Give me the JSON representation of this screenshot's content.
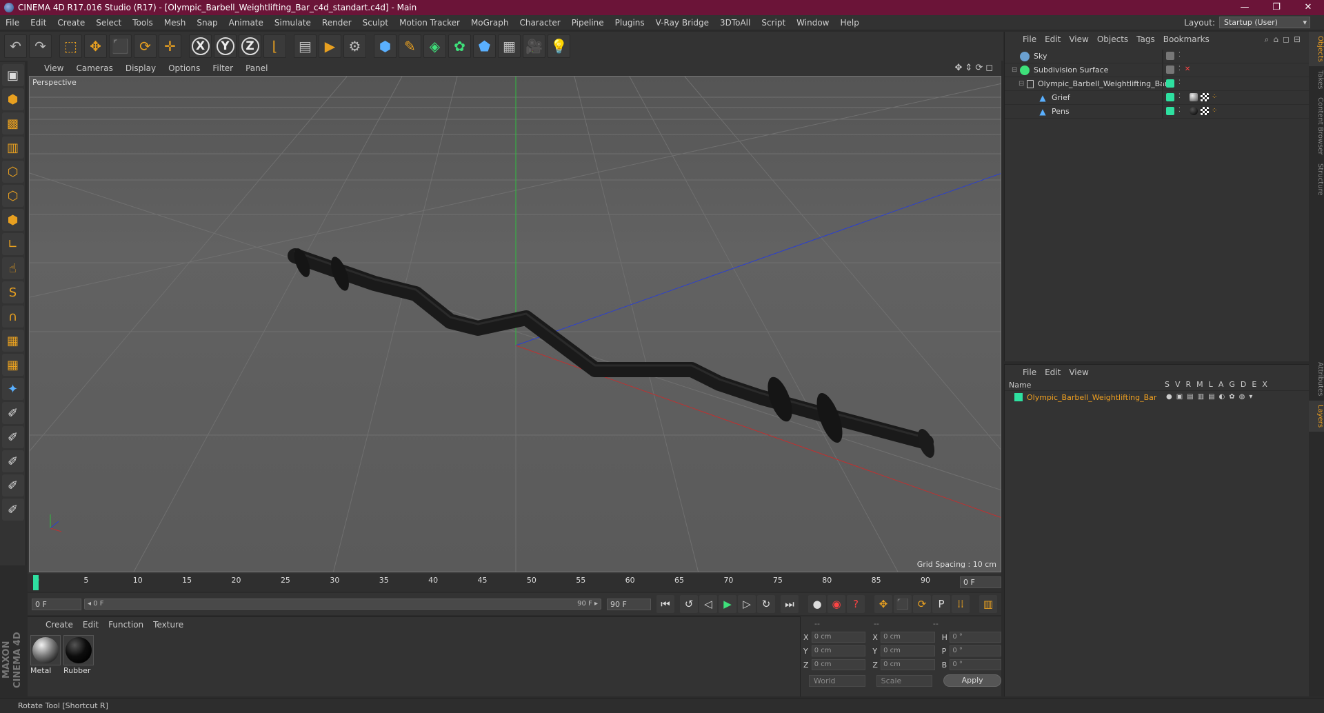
{
  "window": {
    "title": "CINEMA 4D R17.016 Studio (R17) - [Olympic_Barbell_Weightlifting_Bar_c4d_standart.c4d] - Main",
    "minimize": "—",
    "restore": "❐",
    "close": "✕"
  },
  "menubar": {
    "items": [
      "File",
      "Edit",
      "Create",
      "Select",
      "Tools",
      "Mesh",
      "Snap",
      "Animate",
      "Simulate",
      "Render",
      "Sculpt",
      "Motion Tracker",
      "MoGraph",
      "Character",
      "Pipeline",
      "Plugins",
      "V-Ray Bridge",
      "3DToAll",
      "Script",
      "Window",
      "Help"
    ],
    "layout_label": "Layout:",
    "layout_value": "Startup (User)"
  },
  "toolbar": {
    "undo": "↶",
    "redo": "↷",
    "select": "⬚",
    "move": "✥",
    "scale": "⬛",
    "rotate": "⟳",
    "add": "✛",
    "x": "X",
    "y": "Y",
    "z": "Z",
    "coord": "⌊",
    "render_view": "▤",
    "render": "▶",
    "render_settings": "⚙",
    "cube": "⬢",
    "pen": "✎",
    "subdiv": "◈",
    "array": "✿",
    "deformer": "⬟",
    "floor": "▦",
    "camera": "🎥",
    "light": "💡"
  },
  "left_tools": {
    "items": [
      {
        "name": "make-editable-icon",
        "glyph": "▣"
      },
      {
        "name": "model-mode-icon",
        "glyph": "⬢"
      },
      {
        "name": "texture-mode-icon",
        "glyph": "▩"
      },
      {
        "name": "workplane-icon",
        "glyph": "▥"
      },
      {
        "name": "points-mode-icon",
        "glyph": "⬡"
      },
      {
        "name": "edges-mode-icon",
        "glyph": "⬡"
      },
      {
        "name": "polygons-mode-icon",
        "glyph": "⬢"
      },
      {
        "name": "axis-mode-icon",
        "glyph": "∟"
      },
      {
        "name": "tweak-icon",
        "glyph": "☝"
      },
      {
        "name": "snap-icon",
        "glyph": "S"
      },
      {
        "name": "magnet-icon",
        "glyph": "∩"
      },
      {
        "name": "grid-lock-icon",
        "glyph": "▦"
      },
      {
        "name": "grid-sync-icon",
        "glyph": "▦"
      },
      {
        "name": "python-icon",
        "glyph": "✦"
      },
      {
        "name": "sculpt-brush-icon",
        "glyph": "✐"
      },
      {
        "name": "sculpt-smooth-icon",
        "glyph": "✐"
      },
      {
        "name": "sculpt-pull-icon",
        "glyph": "✐"
      },
      {
        "name": "sculpt-grab-icon",
        "glyph": "✐"
      },
      {
        "name": "sculpt-knife-icon",
        "glyph": "✐"
      }
    ]
  },
  "viewport": {
    "menu": [
      "View",
      "Cameras",
      "Display",
      "Options",
      "Filter",
      "Panel"
    ],
    "nav_icons": "✥⇕⟳◻",
    "label": "Perspective",
    "grid_spacing": "Grid Spacing : 10 cm"
  },
  "timeline": {
    "ticks": [
      "0",
      "5",
      "10",
      "15",
      "20",
      "25",
      "30",
      "35",
      "40",
      "45",
      "50",
      "55",
      "60",
      "65",
      "70",
      "75",
      "80",
      "85",
      "90"
    ],
    "current_frame": "0 F",
    "start_field": "0 F",
    "scrub_start": "◂ 0 F",
    "scrub_end": "90 F ▸",
    "end_field": "90 F"
  },
  "transport": {
    "first": "⏮",
    "prev_key": "↺",
    "prev": "◁",
    "play": "▶",
    "next": "▷",
    "next_key": "↻",
    "last": "⏭",
    "record": "●",
    "autokey": "◉",
    "keyinfo": "?",
    "pos": "✥",
    "scale": "⬛",
    "rot": "⟳",
    "param": "P",
    "pla": "⁞⁞",
    "timeline": "▥"
  },
  "materials": {
    "menu": [
      "Create",
      "Edit",
      "Function",
      "Texture"
    ],
    "items": [
      {
        "name": "Metal",
        "color": "#9a9a9a"
      },
      {
        "name": "Rubber",
        "color": "#111111"
      }
    ]
  },
  "coordinates": {
    "head": [
      "--",
      "--",
      "--"
    ],
    "rows": [
      {
        "a1": "X",
        "v1": "0 cm",
        "a2": "X",
        "v2": "0 cm",
        "a3": "H",
        "v3": "0 °"
      },
      {
        "a1": "Y",
        "v1": "0 cm",
        "a2": "Y",
        "v2": "0 cm",
        "a3": "P",
        "v3": "0 °"
      },
      {
        "a1": "Z",
        "v1": "0 cm",
        "a2": "Z",
        "v2": "0 cm",
        "a3": "B",
        "v3": "0 °"
      }
    ],
    "world": "World",
    "scale": "Scale",
    "apply": "Apply"
  },
  "status": {
    "text": "Rotate Tool [Shortcut R]"
  },
  "brand": "MAXON CINEMA 4D",
  "objects": {
    "menu": [
      "File",
      "Edit",
      "View",
      "Objects",
      "Tags",
      "Bookmarks"
    ],
    "header_icons": "⌕⌂◻⊟",
    "rows": [
      {
        "label": "Sky",
        "indent": 0,
        "tree": "",
        "icon_color": "#6aa0d0"
      },
      {
        "label": "Subdivision Surface",
        "indent": 0,
        "tree": "⊟",
        "icon_color": "#3ee07a"
      },
      {
        "label": "Olympic_Barbell_Weightlifting_Bar",
        "indent": 1,
        "tree": "⊟",
        "icon_color": "#cccccc"
      },
      {
        "label": "Grief",
        "indent": 2,
        "tree": "",
        "icon_color": "#5ab0ff"
      },
      {
        "label": "Pens",
        "indent": 2,
        "tree": "",
        "icon_color": "#5ab0ff"
      }
    ]
  },
  "layers": {
    "menu": [
      "File",
      "Edit",
      "View"
    ],
    "header_name": "Name",
    "header_cols": [
      "S",
      "V",
      "R",
      "M",
      "L",
      "A",
      "G",
      "D",
      "E",
      "X"
    ],
    "row_label": "Olympic_Barbell_Weightlifting_Bar",
    "row_flags": "●▣▤▥▤◐✿◍▾"
  },
  "side_tabs": [
    "Objects",
    "Takes",
    "Content Browser",
    "Structure",
    "Attributes",
    "Layers"
  ]
}
